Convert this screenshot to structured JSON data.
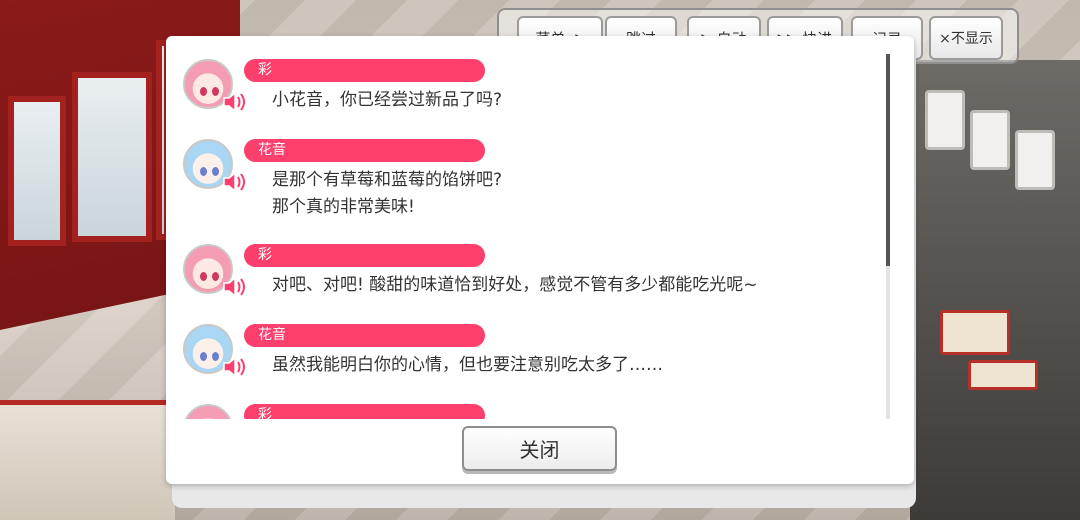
{
  "controls": {
    "menu": "菜单",
    "skip": "跳过",
    "auto": "自动",
    "fast_forward": "快进",
    "log": "记录",
    "hide": "×不显示"
  },
  "icons": {
    "speaker": "speaker-icon",
    "play": "play-icon",
    "fast_forward": "fast-forward-icon"
  },
  "colors": {
    "name_bar": "#fc3f6c",
    "speaker": "#fc3f6c"
  },
  "log": {
    "entries": [
      {
        "speaker": "彩",
        "lines": [
          "小花音，你已经尝过新品了吗?"
        ]
      },
      {
        "speaker": "花音",
        "lines": [
          "是那个有草莓和蓝莓的馅饼吧?",
          "那个真的非常美味!"
        ]
      },
      {
        "speaker": "彩",
        "lines": [
          "对吧、对吧! 酸甜的味道恰到好处，感觉不管有多少都能吃光呢~"
        ]
      },
      {
        "speaker": "花音",
        "lines": [
          "虽然我能明白你的心情，但也要注意别吃太多了……"
        ]
      },
      {
        "speaker": "彩",
        "lines": []
      }
    ]
  },
  "close_label": "关闭"
}
